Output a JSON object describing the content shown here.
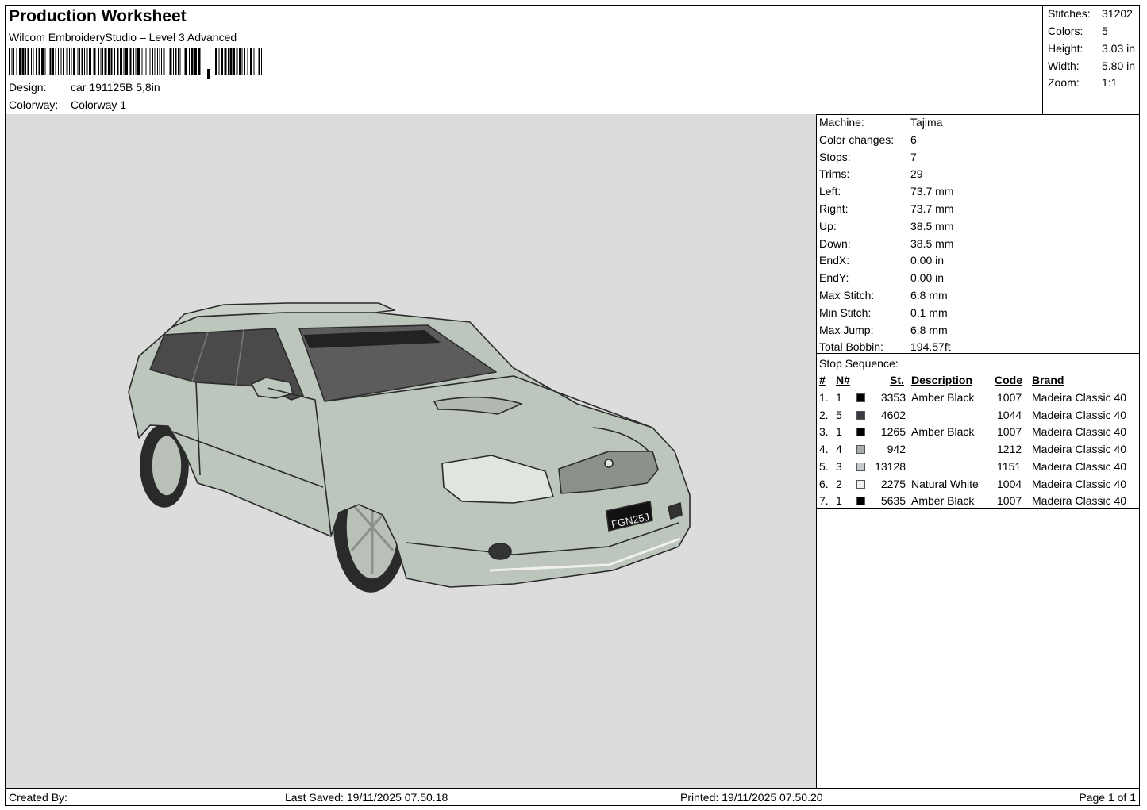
{
  "header": {
    "title": "Production Worksheet",
    "software": "Wilcom EmbroideryStudio – Level 3 Advanced",
    "barcode_text": "car 191125B 5,8in",
    "design_label": "Design:",
    "design_value": "car 191125B 5,8in",
    "colorway_label": "Colorway:",
    "colorway_value": "Colorway 1"
  },
  "stats": [
    {
      "label": "Stitches:",
      "value": "31202"
    },
    {
      "label": "Colors:",
      "value": "5"
    },
    {
      "label": "Height:",
      "value": "3.03 in"
    },
    {
      "label": "Width:",
      "value": "5.80 in"
    },
    {
      "label": "Zoom:",
      "value": "1:1"
    }
  ],
  "preview": {
    "plate_text": "FGN25J",
    "colors": {
      "background": "#dcdcdc",
      "body": "#bcc6bc",
      "body_dark": "#a9b3a9",
      "outline": "#2b2b2b",
      "glass": "#4a4a4a",
      "glass_light": "#5c5c5c"
    }
  },
  "machine_info": [
    {
      "label": "Machine:",
      "value": "Tajima"
    },
    {
      "label": "Color changes:",
      "value": "6"
    },
    {
      "label": "Stops:",
      "value": "7"
    },
    {
      "label": "Trims:",
      "value": "29"
    },
    {
      "label": "Left:",
      "value": "73.7 mm"
    },
    {
      "label": "Right:",
      "value": "73.7 mm"
    },
    {
      "label": "Up:",
      "value": "38.5 mm"
    },
    {
      "label": "Down:",
      "value": "38.5 mm"
    },
    {
      "label": "EndX:",
      "value": "0.00 in"
    },
    {
      "label": "EndY:",
      "value": "0.00 in"
    },
    {
      "label": "Max Stitch:",
      "value": "6.8 mm"
    },
    {
      "label": "Min Stitch:",
      "value": "0.1 mm"
    },
    {
      "label": "Max Jump:",
      "value": "6.8 mm"
    },
    {
      "label": "Total Bobbin:",
      "value": "194.57ft"
    }
  ],
  "stop_sequence": {
    "title": "Stop Sequence:",
    "headers": {
      "num": "#",
      "n": "N#",
      "st": "St.",
      "description": "Description",
      "code": "Code",
      "brand": "Brand"
    },
    "rows": [
      {
        "num": "1.",
        "n": "1",
        "color": "#000000",
        "st": "3353",
        "description": "Amber Black",
        "code": "1007",
        "brand": "Madeira Classic 40"
      },
      {
        "num": "2.",
        "n": "5",
        "color": "#3a3a40",
        "st": "4602",
        "description": "",
        "code": "1044",
        "brand": "Madeira Classic 40"
      },
      {
        "num": "3.",
        "n": "1",
        "color": "#000000",
        "st": "1265",
        "description": "Amber Black",
        "code": "1007",
        "brand": "Madeira Classic 40"
      },
      {
        "num": "4.",
        "n": "4",
        "color": "#a8adb0",
        "st": "942",
        "description": "",
        "code": "1212",
        "brand": "Madeira Classic 40"
      },
      {
        "num": "5.",
        "n": "3",
        "color": "#c4cad0",
        "st": "13128",
        "description": "",
        "code": "1151",
        "brand": "Madeira Classic 40"
      },
      {
        "num": "6.",
        "n": "2",
        "color": "#f2f2f2",
        "st": "2275",
        "description": "Natural White",
        "code": "1004",
        "brand": "Madeira Classic 40"
      },
      {
        "num": "7.",
        "n": "1",
        "color": "#000000",
        "st": "5635",
        "description": "Amber Black",
        "code": "1007",
        "brand": "Madeira Classic 40"
      }
    ]
  },
  "footer": {
    "created_by": "Created By:",
    "last_saved": "Last Saved: 19/11/2025 07.50.18",
    "printed": "Printed: 19/11/2025 07.50.20",
    "page": "Page 1 of 1"
  }
}
